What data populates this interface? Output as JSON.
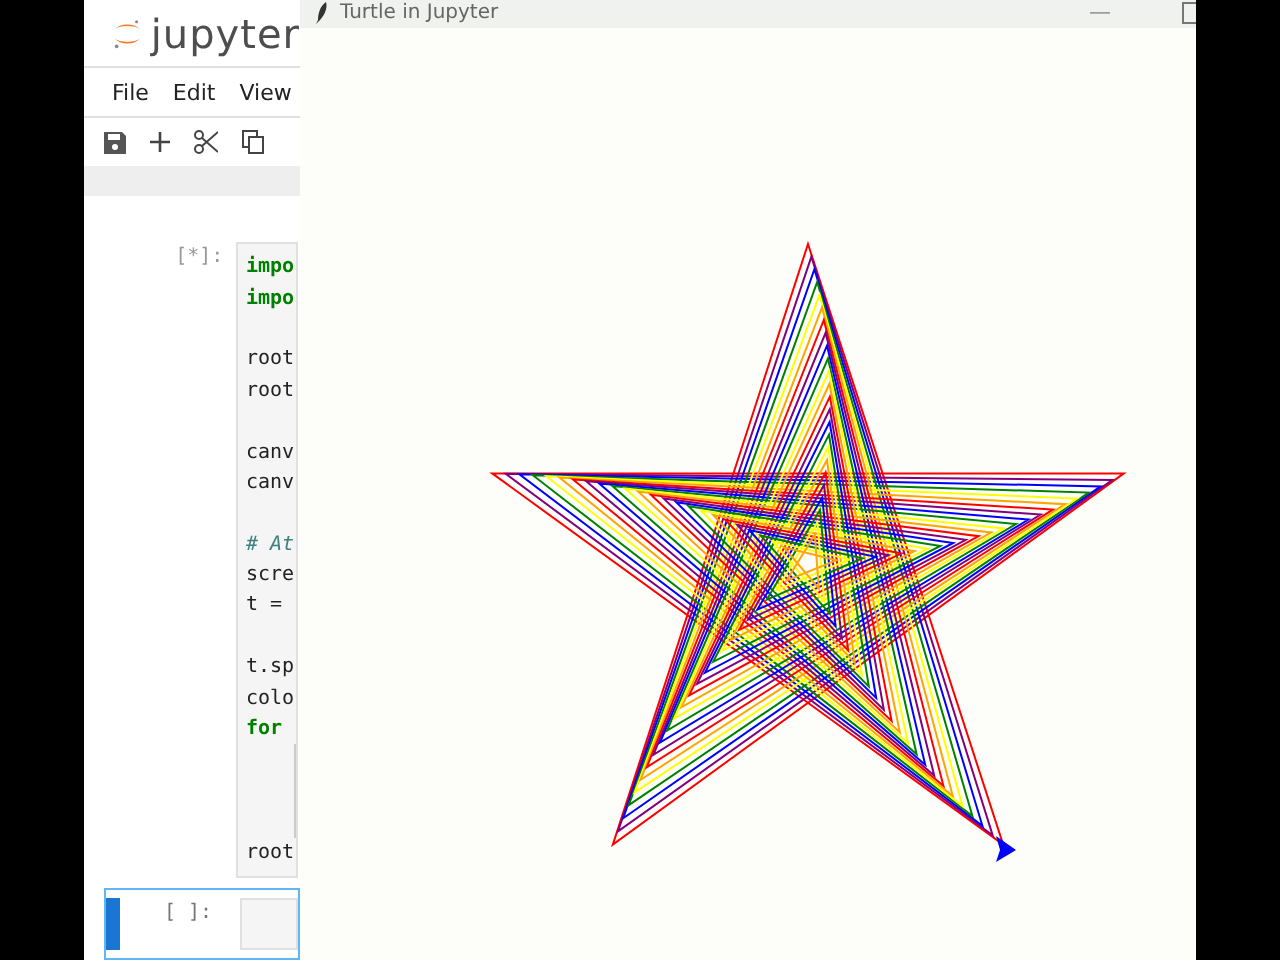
{
  "notebook": {
    "logo": "jupyter",
    "menu": [
      "File",
      "Edit",
      "View"
    ],
    "cells": [
      {
        "prompt": "[*]:",
        "running": true,
        "selected": false,
        "lines": [
          {
            "text": "impo",
            "kind": "keyword"
          },
          {
            "text": "impo",
            "kind": "keyword"
          },
          {
            "kind": "blank"
          },
          {
            "text": "root",
            "kind": "plain"
          },
          {
            "text": "root",
            "kind": "plain"
          },
          {
            "kind": "blank"
          },
          {
            "text": "canv",
            "kind": "plain"
          },
          {
            "text": "canv",
            "kind": "plain"
          },
          {
            "kind": "blank"
          },
          {
            "text": "# At",
            "kind": "comment"
          },
          {
            "text": "scre",
            "kind": "plain"
          },
          {
            "text": "t =",
            "kind": "plain"
          },
          {
            "kind": "blank"
          },
          {
            "text": "t.sp",
            "kind": "plain"
          },
          {
            "text": "colo",
            "kind": "plain"
          },
          {
            "text": "for",
            "kind": "keyword"
          },
          {
            "kind": "indent"
          },
          {
            "kind": "indent"
          },
          {
            "kind": "indent"
          },
          {
            "text": "root",
            "kind": "plain"
          }
        ]
      },
      {
        "prompt": "[ ]:",
        "running": false,
        "selected": true
      }
    ]
  },
  "turtle_window": {
    "title": "Turtle in Jupyter",
    "minimize": "—"
  }
}
